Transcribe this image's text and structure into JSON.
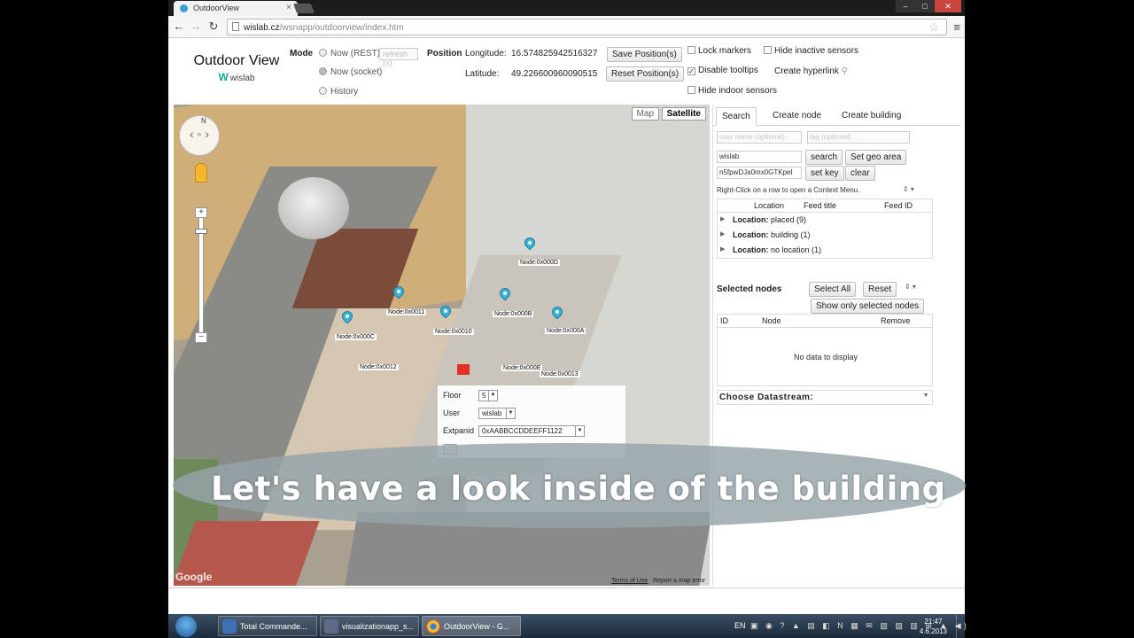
{
  "browser": {
    "tab_title": "OutdoorView",
    "tab_close": "×",
    "url_host": "wislab.cz",
    "url_path": "/wsnapp/outdoorview/index.htm",
    "win_min": "–",
    "win_max": "□",
    "win_close": "✕"
  },
  "header": {
    "brand_title": "Outdoor View",
    "brand_sub": "wislab",
    "mode_label": "Mode",
    "mode_options": [
      "Now (REST)",
      "Now (socket)",
      "History"
    ],
    "refresh_placeholder": "refresh (s)",
    "position_label": "Position",
    "longitude_label": "Longitude:",
    "longitude_value": "16.574825942516327",
    "latitude_label": "Latitude:",
    "latitude_value": "49.226600960090515",
    "save_position": "Save Position(s)",
    "reset_position": "Reset Position(s)",
    "lock_markers": "Lock markers",
    "hide_inactive": "Hide inactive sensors",
    "disable_tooltips": "Disable tooltips",
    "create_hyperlink": "Create hyperlink",
    "hide_indoor": "Hide indoor sensors"
  },
  "map": {
    "map_btn": "Map",
    "satellite_btn": "Satellite",
    "compass_n": "N",
    "zoom_plus": "+",
    "zoom_minus": "−",
    "markers": [
      {
        "label": "Node:0x000D"
      },
      {
        "label": "Node:0x0011"
      },
      {
        "label": "Node:0x000B"
      },
      {
        "label": "Node:0x0010"
      },
      {
        "label": "Node:0x000A"
      },
      {
        "label": "Node:0x000C"
      },
      {
        "label": "Node:0x0012"
      },
      {
        "label": "Node:0x000E"
      },
      {
        "label": "Node:0x0013"
      }
    ],
    "popup": {
      "floor_label": "Floor",
      "floor_value": "5",
      "user_label": "User",
      "user_value": "wislab",
      "extpanid_label": "Extpanid",
      "extpanid_value": "0xAABBCCDDEEFF1122"
    },
    "google": "Google",
    "terms": "Terms of Use",
    "report": "Report a map error"
  },
  "panel": {
    "tabs": [
      "Search",
      "Create node",
      "Create building"
    ],
    "user_name_placeholder": "user name (optional)",
    "tag_placeholder": "tag (optional)",
    "search_value": "wislab",
    "search_btn": "search",
    "geo_btn": "Set geo area",
    "key_value": "n5fpwDJa0mx0GTKpeI",
    "set_key_btn": "set key",
    "clear_btn": "clear",
    "hint": "Right-Click on a row to open a Context Menu.",
    "columns": [
      "Location",
      "Feed title",
      "Feed ID"
    ],
    "rows": [
      {
        "key": "Location:",
        "value": "placed (9)"
      },
      {
        "key": "Location:",
        "value": "building (1)"
      },
      {
        "key": "Location:",
        "value": "no location (1)"
      }
    ],
    "selected_nodes": "Selected nodes",
    "select_all": "Select All",
    "reset": "Reset",
    "show_only_selected": "Show only selected nodes",
    "sel_columns": [
      "ID",
      "Node",
      "Remove"
    ],
    "no_data": "No data to display",
    "choose_datastream": "Choose Datastream:"
  },
  "caption": "Let's have a look inside of the building",
  "taskbar": {
    "tasks": [
      "Total Commande...",
      "visualizationapp_s...",
      "OutdoorView - G..."
    ],
    "lang": "EN",
    "time": "21:47",
    "date": "4.6.2013"
  }
}
